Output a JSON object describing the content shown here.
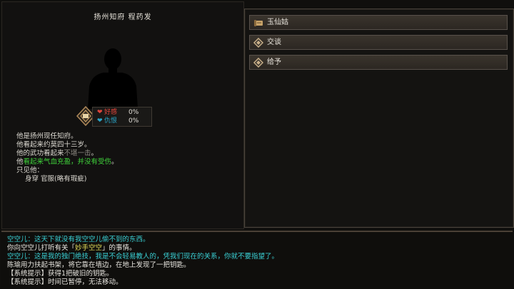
{
  "npc": {
    "title": "扬州知府  程药发",
    "relations": {
      "favor_label": "好感",
      "favor_value": "0%",
      "hatred_label": "仇恨",
      "hatred_value": "0%",
      "heart_icon": "heart-icon"
    },
    "description": {
      "line1": "他是扬州现任知府。",
      "line2": "他看起来约莫四十三岁。",
      "line3_prefix": "他的武功看起来",
      "line3_gray": "不堪一击",
      "line3_suffix": "。",
      "line4_prefix": "他",
      "line4_green": "看起来气血充盈，并没有受伤",
      "line4_suffix": "。",
      "line5": "只见他：",
      "line6": "身穿  官服(略有瑕疵)"
    }
  },
  "menu": {
    "items": [
      {
        "label": "玉仙姑",
        "icon": "scroll-icon"
      },
      {
        "label": "交谈",
        "icon": "diamond-icon"
      },
      {
        "label": "给予",
        "icon": "diamond-icon"
      }
    ]
  },
  "log": {
    "lines": [
      {
        "text": "空空儿：这天下就没有我空空儿偷不到的东西。",
        "color": "cyan"
      },
      {
        "prefix": "你向空空儿打听有关「",
        "highlight": "妙手空空",
        "suffix": "」的事情。",
        "color": "white"
      },
      {
        "text": "空空儿：这是我的独门绝技，我是不会轻易教人的，凭我们现在的关系，你就不要指望了。",
        "color": "cyan"
      },
      {
        "text": "陈瑜用力扶起书架，将它靠在墙边，在地上发现了一把钥匙。",
        "color": "white"
      },
      {
        "text": "【系统提示】获得1把破旧的钥匙。",
        "color": "white"
      },
      {
        "text": "【系统提示】时间已暂停，无法移动。",
        "color": "white"
      }
    ]
  },
  "colors": {
    "favor": "#e0453b",
    "hatred": "#2aa6c9",
    "healthy": "#3fd13a",
    "weak": "#8b8880",
    "log_cyan": "#3ad1d6",
    "log_highlight": "#e4de5a"
  }
}
